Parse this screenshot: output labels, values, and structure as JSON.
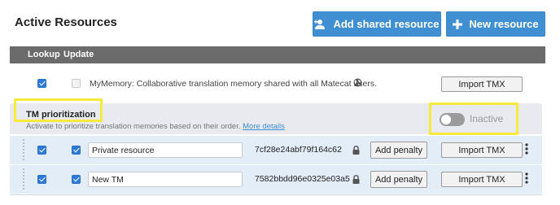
{
  "header": {
    "title": "Active Resources",
    "add_shared_label": "Add shared resource",
    "new_resource_label": "New resource"
  },
  "columns": {
    "lookup": "Lookup",
    "update": "Update"
  },
  "mymemory": {
    "lookup_checked": true,
    "update_checked": false,
    "description": "MyMemory: Collaborative translation memory shared with all Matecat users.",
    "import_label": "Import TMX"
  },
  "prioritization": {
    "title": "TM prioritization",
    "description": "Activate to prioritize translation memories based on their order.",
    "more_details": "More details",
    "toggle_state": "Inactive"
  },
  "tms": [
    {
      "name": "Private resource",
      "key": "7cf28e24abf79f164c62",
      "lookup_checked": true,
      "update_checked": true,
      "penalty_label": "Add penalty",
      "import_label": "Import TMX"
    },
    {
      "name": "New TM",
      "key": "7582bbdd96e0325e03a5",
      "lookup_checked": true,
      "update_checked": true,
      "penalty_label": "Add penalty",
      "import_label": "Import TMX"
    }
  ],
  "colors": {
    "primary": "#3f8fd2",
    "header_bar": "#6b6b6b",
    "highlight": "#f6ea3c",
    "row_bg": "#e2edf8"
  }
}
